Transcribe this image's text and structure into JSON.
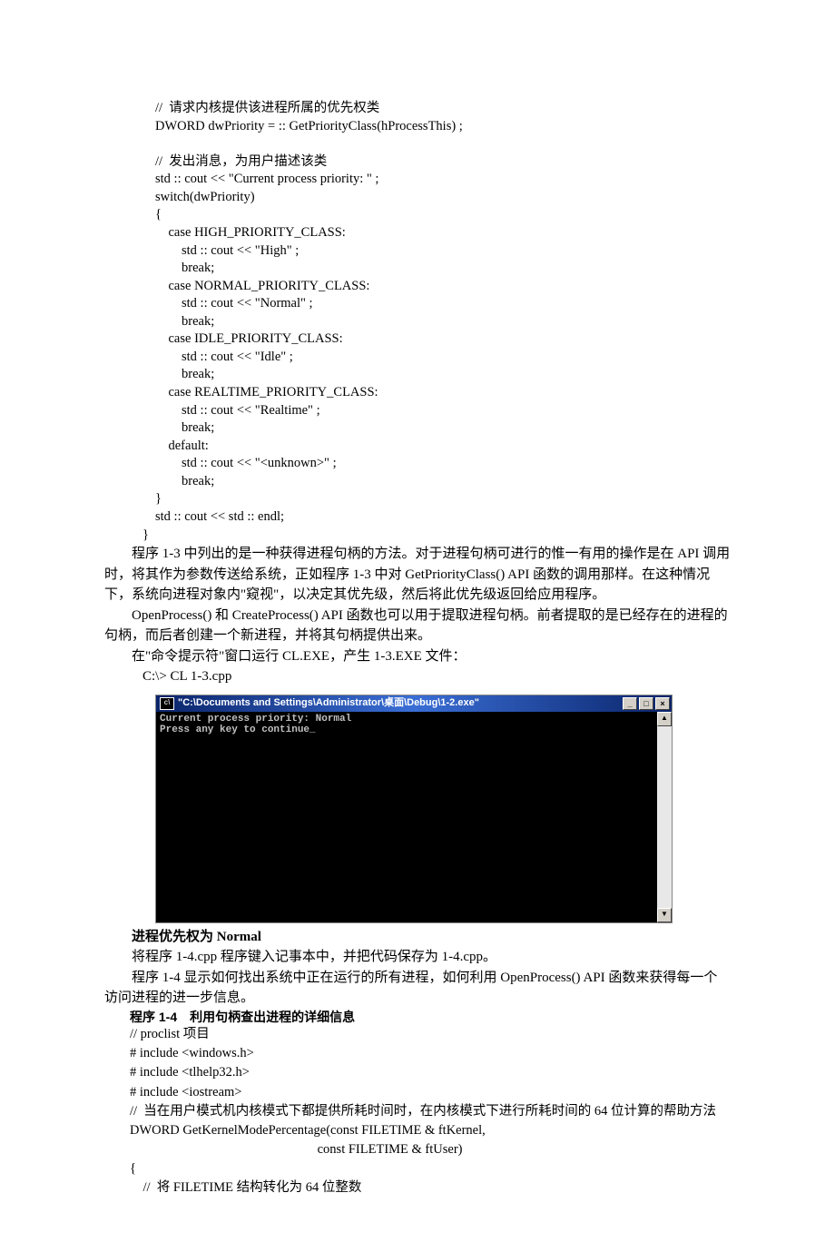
{
  "code_block_1": [
    "//  请求内核提供该进程所属的优先权类",
    "DWORD dwPriority = :: GetPriorityClass(hProcessThis) ;",
    "",
    "//  发出消息，为用户描述该类",
    "std :: cout << \"Current process priority: \" ;",
    "switch(dwPriority)",
    "{",
    "    case HIGH_PRIORITY_CLASS:",
    "        std :: cout << \"High\" ;",
    "        break;",
    "    case NORMAL_PRIORITY_CLASS:",
    "        std :: cout << \"Normal\" ;",
    "        break;",
    "    case IDLE_PRIORITY_CLASS:",
    "        std :: cout << \"Idle\" ;",
    "        break;",
    "    case REALTIME_PRIORITY_CLASS:",
    "        std :: cout << \"Realtime\" ;",
    "        break;",
    "    default:",
    "        std :: cout << \"<unknown>\" ;",
    "        break;",
    "}",
    "std :: cout << std :: endl;"
  ],
  "code_block_1_close": "}",
  "para1": "程序 1-3 中列出的是一种获得进程句柄的方法。对于进程句柄可进行的惟一有用的操作是在 API 调用时，将其作为参数传送给系统，正如程序 1-3 中对 GetPriorityClass() API 函数的调用那样。在这种情况下，系统向进程对象内\"窥视\"，以决定其优先级，然后将此优先级返回给应用程序。",
  "para2": "OpenProcess()  和 CreateProcess() API 函数也可以用于提取进程句柄。前者提取的是已经存在的进程的句柄，而后者创建一个新进程，并将其句柄提供出来。",
  "para3": "在\"命令提示符\"窗口运行 CL.EXE，产生 1-3.EXE 文件：",
  "para3_cmd": "C:\\> CL 1-3.cpp",
  "cmd_window": {
    "title": "\"C:\\Documents and Settings\\Administrator\\桌面\\Debug\\1-2.exe\"",
    "line1": "Current process priority: Normal",
    "line2": "Press any key to continue_",
    "min": "_",
    "max": "□",
    "close": "×",
    "up": "▲",
    "down": "▼"
  },
  "caption1": "进程优先权为 Normal",
  "para4": "将程序 1-4.cpp 程序键入记事本中，并把代码保存为 1-4.cpp。",
  "para5": "程序 1-4 显示如何找出系统中正在运行的所有进程，如何利用 OpenProcess() API 函数来获得每一个访问进程的进一步信息。",
  "heading14": "程序 1-4　利用句柄查出进程的详细信息",
  "code_block_2": [
    "// proclist 项目",
    "# include <windows.h>",
    "# include <tlhelp32.h>",
    "# include <iostream>",
    "//  当在用户模式机内核模式下都提供所耗时间时，在内核模式下进行所耗时间的 64 位计算的帮助方法",
    "DWORD GetKernelModePercentage(const FILETIME & ftKernel,",
    "                                                         const FILETIME & ftUser)",
    "{",
    "    //  将 FILETIME 结构转化为 64 位整数"
  ]
}
